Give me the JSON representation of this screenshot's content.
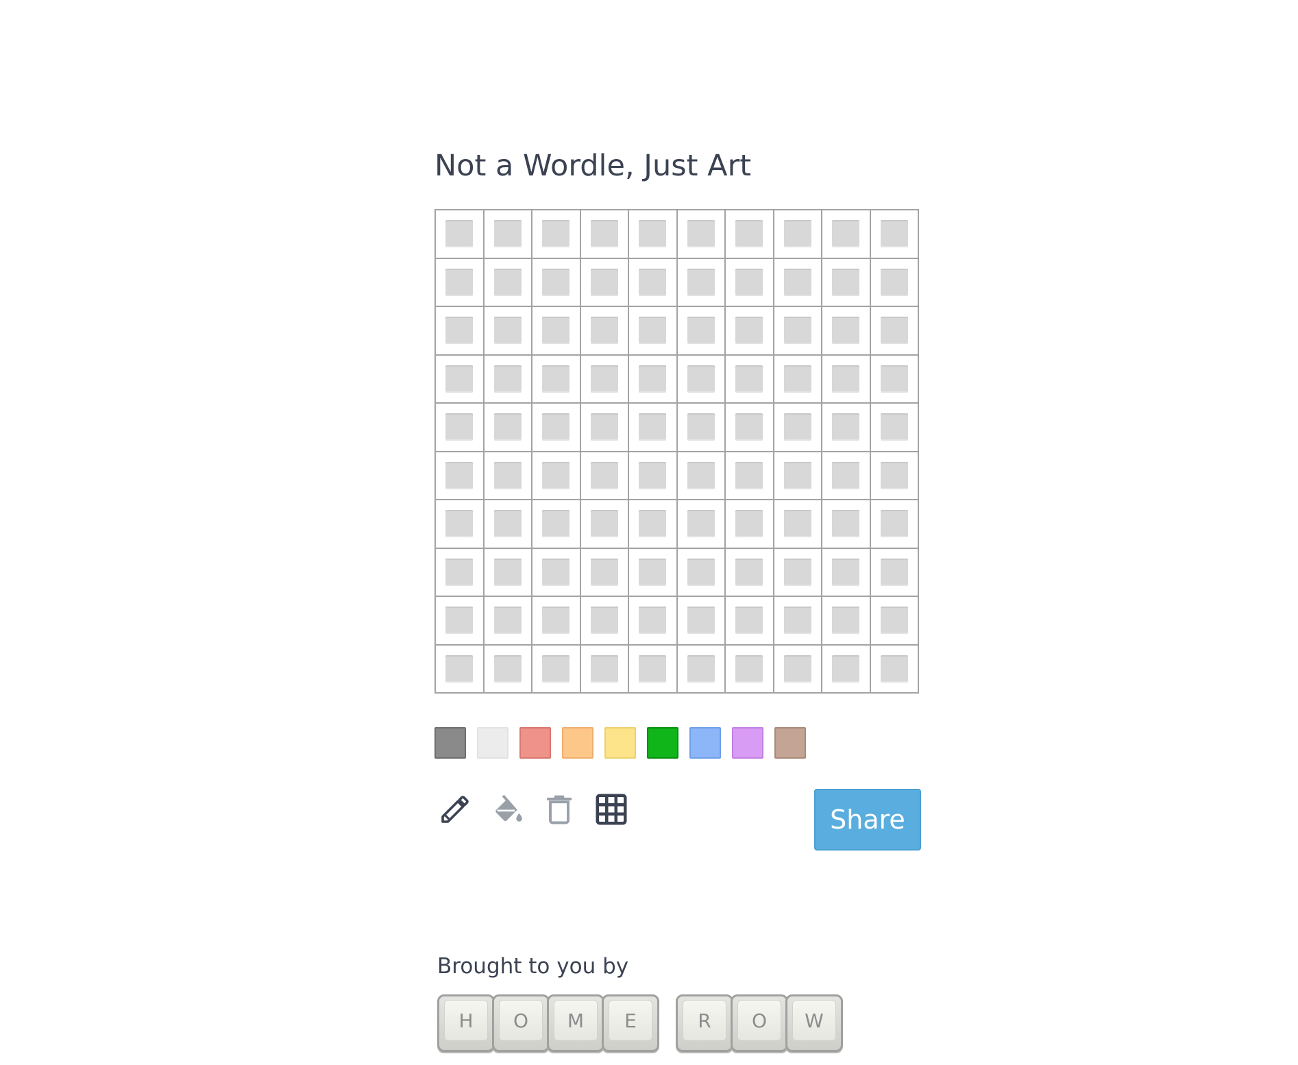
{
  "title": "Not a Wordle, Just Art",
  "grid": {
    "rows": 10,
    "cols": 10,
    "cell_color": "#d8d8d8",
    "line_color": "#a3a3a3"
  },
  "palette": [
    {
      "name": "gray-swatch",
      "color": "#8a8a8a",
      "border": "#6e6e6e"
    },
    {
      "name": "white-swatch",
      "color": "#ececec",
      "border": "#e2e2e2"
    },
    {
      "name": "red-swatch",
      "color": "#ee928a",
      "border": "#d9766e"
    },
    {
      "name": "orange-swatch",
      "color": "#fec78a",
      "border": "#eeaf6c"
    },
    {
      "name": "yellow-swatch",
      "color": "#fde38a",
      "border": "#ecd06c"
    },
    {
      "name": "green-swatch",
      "color": "#10b51a",
      "border": "#0a8f12"
    },
    {
      "name": "blue-swatch",
      "color": "#8cb6f8",
      "border": "#6f9ee8"
    },
    {
      "name": "purple-swatch",
      "color": "#d99cf5",
      "border": "#c37fe2"
    },
    {
      "name": "brown-swatch",
      "color": "#c4a494",
      "border": "#a98a79"
    }
  ],
  "tools": [
    {
      "name": "pencil-icon",
      "active": true
    },
    {
      "name": "paint-bucket-icon",
      "active": false
    },
    {
      "name": "trash-icon",
      "active": false
    },
    {
      "name": "grid-icon",
      "active": true
    }
  ],
  "share_label": "Share",
  "credit": {
    "text": "Brought to you by",
    "keys": [
      "H",
      "O",
      "M",
      "E",
      "R",
      "O",
      "W"
    ]
  }
}
